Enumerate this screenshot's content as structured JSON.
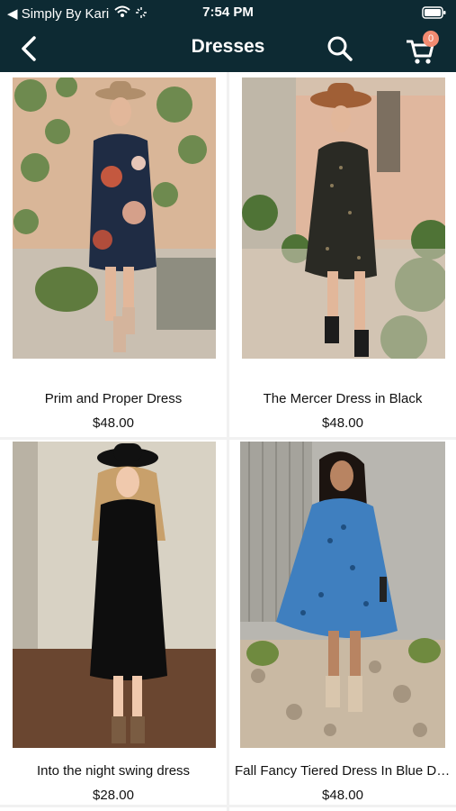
{
  "status_bar": {
    "carrier": "◀ Simply By Kari",
    "time": "7:54 PM"
  },
  "nav": {
    "title": "Dresses",
    "cart_count": "0"
  },
  "products": [
    {
      "name": "Prim and Proper Dress",
      "price": "$48.00"
    },
    {
      "name": "The Mercer Dress in Black",
      "price": "$48.00"
    },
    {
      "name": "Into the night swing dress",
      "price": "$28.00"
    },
    {
      "name": "Fall Fancy Tiered Dress In Blue Da...",
      "price": "$48.00"
    }
  ],
  "colors": {
    "header_bg": "#0d2a33",
    "badge": "#f28b71"
  }
}
